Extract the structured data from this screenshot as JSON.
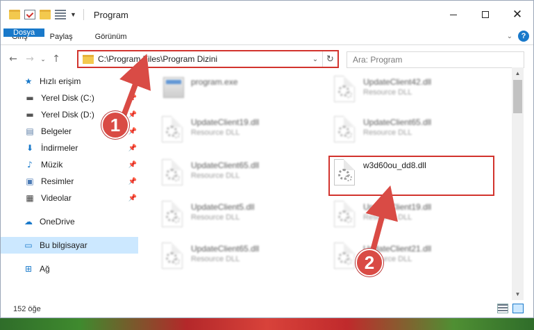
{
  "window": {
    "title": "Program"
  },
  "ribbon": {
    "tabs": [
      "Dosya",
      "Giriş",
      "Paylaş",
      "Görünüm"
    ]
  },
  "address": {
    "path": "C:\\Program Files\\Program Dizini"
  },
  "search": {
    "placeholder": "Ara: Program"
  },
  "sidebar": {
    "quick_access": "Hızlı erişim",
    "items": [
      {
        "label": "Yerel Disk (C:)",
        "icon": "drive-icon"
      },
      {
        "label": "Yerel Disk (D:)",
        "icon": "drive-icon"
      },
      {
        "label": "Belgeler",
        "icon": "documents-icon"
      },
      {
        "label": "İndirmeler",
        "icon": "download-icon"
      },
      {
        "label": "Müzik",
        "icon": "music-icon"
      },
      {
        "label": "Resimler",
        "icon": "pictures-icon"
      },
      {
        "label": "Videolar",
        "icon": "video-icon"
      }
    ],
    "onedrive": "OneDrive",
    "this_pc": "Bu bilgisayar",
    "network": "Ağ"
  },
  "files": [
    {
      "name": "program.exe",
      "type": ""
    },
    {
      "name": "UpdateClient42.dll",
      "type": "Resource DLL"
    },
    {
      "name": "UpdateClient19.dll",
      "type": "Resource DLL"
    },
    {
      "name": "UpdateClient65.dll",
      "type": "Resource DLL"
    },
    {
      "name": "UpdateClient65.dll",
      "type": "Resource DLL"
    },
    {
      "name": "w3d60ou_dd8.dll",
      "type": ""
    },
    {
      "name": "UpdateClient5.dll",
      "type": "Resource DLL"
    },
    {
      "name": "UpdateClient19.dll",
      "type": "Resource DLL"
    },
    {
      "name": "UpdateClient65.dll",
      "type": "Resource DLL"
    },
    {
      "name": "UpdateClient21.dll",
      "type": "Resource DLL"
    }
  ],
  "status": {
    "count": "152 öğe"
  },
  "annotations": {
    "step1": "1",
    "step2": "2",
    "color": "#d2332d"
  }
}
